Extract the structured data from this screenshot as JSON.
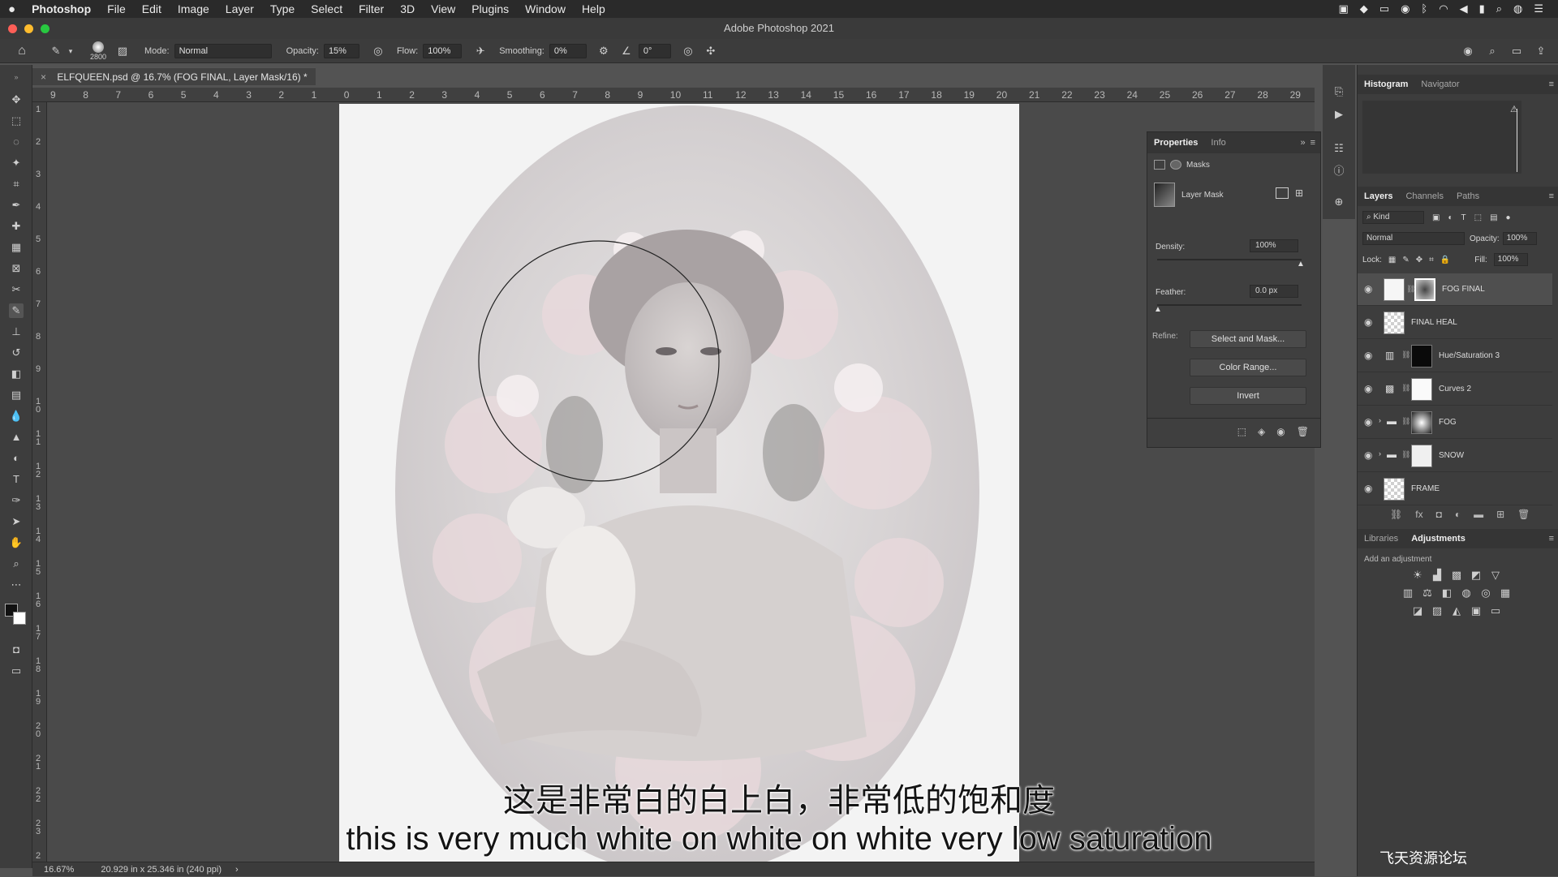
{
  "menubar": {
    "apple": "",
    "items": [
      "Photoshop",
      "File",
      "Edit",
      "Image",
      "Layer",
      "Type",
      "Select",
      "Filter",
      "3D",
      "View",
      "Plugins",
      "Window",
      "Help"
    ]
  },
  "window": {
    "title": "Adobe Photoshop 2021"
  },
  "options": {
    "brush_size": "2800",
    "mode_label": "Mode:",
    "mode_value": "Normal",
    "opacity_label": "Opacity:",
    "opacity_value": "15%",
    "flow_label": "Flow:",
    "flow_value": "100%",
    "smoothing_label": "Smoothing:",
    "smoothing_value": "0%",
    "angle_value": "0°"
  },
  "document": {
    "tab_title": "ELFQUEEN.psd @ 16.7% (FOG FINAL, Layer Mask/16) *",
    "zoom": "16.67%",
    "doc_info": "20.929 in x 25.346 in (240 ppi)"
  },
  "rulers": {
    "horizontal": [
      "9",
      "8",
      "7",
      "6",
      "5",
      "4",
      "3",
      "2",
      "1",
      "0",
      "1",
      "2",
      "3",
      "4",
      "5",
      "6",
      "7",
      "8",
      "9",
      "10",
      "11",
      "12",
      "13",
      "14",
      "15",
      "16",
      "17",
      "18",
      "19",
      "20",
      "21",
      "22",
      "23",
      "24",
      "25",
      "26",
      "27",
      "28",
      "29"
    ],
    "vertical": [
      "1",
      "2",
      "3",
      "4",
      "5",
      "6",
      "7",
      "8",
      "9",
      "1 0",
      "1 1",
      "1 2",
      "1 3",
      "1 4",
      "1 5",
      "1 6",
      "1 7",
      "1 8",
      "1 9",
      "2 0",
      "2 1",
      "2 2",
      "2 3",
      "2"
    ]
  },
  "subtitles": {
    "cn": "这是非常白的白上白，非常低的饱和度",
    "en": "this is very much white on white on white very low saturation"
  },
  "properties": {
    "tabs": [
      "Properties",
      "Info"
    ],
    "masks_label": "Masks",
    "layer_mask_label": "Layer Mask",
    "density_label": "Density:",
    "density_value": "100%",
    "feather_label": "Feather:",
    "feather_value": "0.0 px",
    "refine_label": "Refine:",
    "select_and_mask": "Select and Mask...",
    "color_range": "Color Range...",
    "invert": "Invert"
  },
  "histogram": {
    "tabs": [
      "Histogram",
      "Navigator"
    ]
  },
  "layers_panel": {
    "tabs": [
      "Layers",
      "Channels",
      "Paths"
    ],
    "kind": "Kind",
    "blend_mode": "Normal",
    "opacity_label": "Opacity:",
    "opacity_value": "100%",
    "lock_label": "Lock:",
    "fill_label": "Fill:",
    "fill_value": "100%",
    "layers": [
      {
        "name": "FOG FINAL"
      },
      {
        "name": "FINAL HEAL"
      },
      {
        "name": "Hue/Saturation 3"
      },
      {
        "name": "Curves 2"
      },
      {
        "name": "FOG"
      },
      {
        "name": "SNOW"
      },
      {
        "name": "FRAME"
      }
    ]
  },
  "adjustments": {
    "tabs": [
      "Libraries",
      "Adjustments"
    ],
    "hint": "Add an adjustment"
  },
  "watermark": "飞天资源论坛"
}
